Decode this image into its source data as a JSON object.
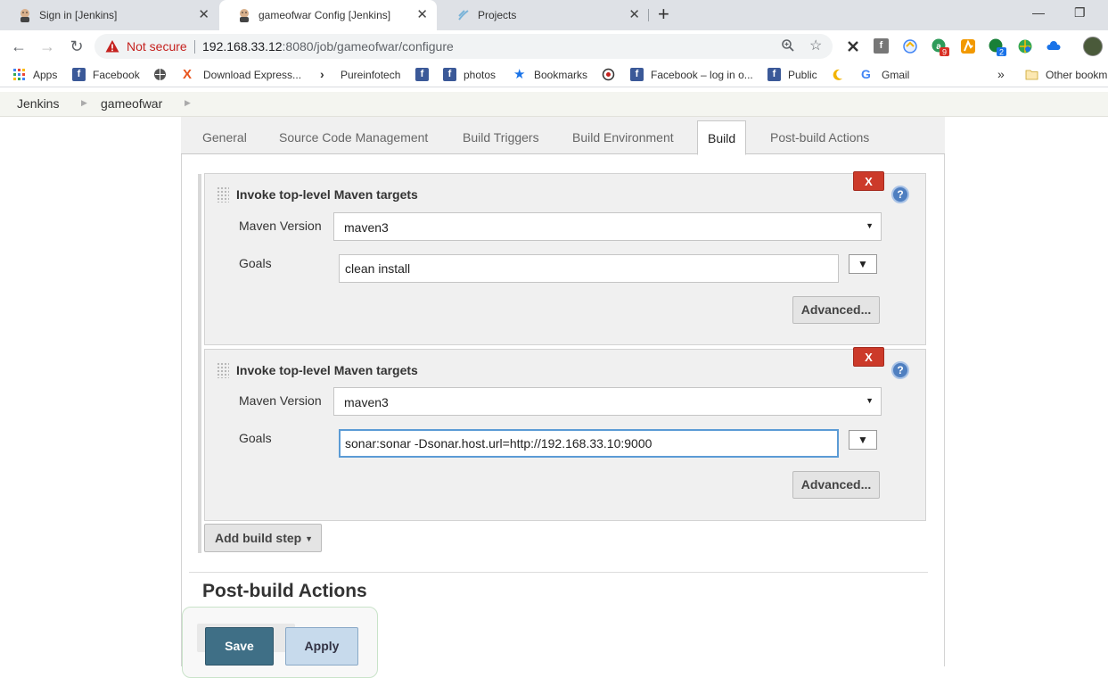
{
  "browser": {
    "tabs": [
      {
        "title": "Sign in [Jenkins]"
      },
      {
        "title": "gameofwar Config [Jenkins]"
      },
      {
        "title": "Projects"
      }
    ],
    "address": {
      "security_label": "Not secure",
      "host": "192.168.33.12",
      "path": ":8080/job/gameofwar/configure"
    },
    "bookmarks": [
      {
        "label": "Apps",
        "icon": "apps-grid-icon"
      },
      {
        "label": "Facebook",
        "icon": "facebook-icon"
      },
      {
        "label": "Download Express...",
        "icon": "x-icon"
      },
      {
        "label": "Pureinfotech",
        "icon": "pureinfotech-icon"
      },
      {
        "label": "photos",
        "icon": "facebook-icon"
      },
      {
        "label": "Bookmarks",
        "icon": "star-icon"
      },
      {
        "label": "Facebook – log in o...",
        "icon": "facebook-icon"
      },
      {
        "label": "Public",
        "icon": "facebook-icon"
      },
      {
        "label": "Gmail",
        "icon": "google-icon"
      },
      {
        "label": "Other bookm",
        "icon": "folder-icon"
      }
    ],
    "extension_badges": {
      "ext_a": "9",
      "ext_b": "2"
    }
  },
  "breadcrumb": [
    "Jenkins",
    "gameofwar"
  ],
  "config_tabs": [
    "General",
    "Source Code Management",
    "Build Triggers",
    "Build Environment",
    "Build",
    "Post-build Actions"
  ],
  "active_tab": "Build",
  "build_steps": [
    {
      "title": "Invoke top-level Maven targets",
      "maven_version_label": "Maven Version",
      "maven_version": "maven3",
      "goals_label": "Goals",
      "goals": "clean install",
      "advanced_label": "Advanced...",
      "delete_label": "X",
      "help_label": "?"
    },
    {
      "title": "Invoke top-level Maven targets",
      "maven_version_label": "Maven Version",
      "maven_version": "maven3",
      "goals_label": "Goals",
      "goals": "sonar:sonar -Dsonar.host.url=http://192.168.33.10:9000",
      "advanced_label": "Advanced...",
      "delete_label": "X",
      "help_label": "?"
    }
  ],
  "add_build_step_label": "Add build step",
  "post_build_title": "Post-build Actions",
  "buttons": {
    "save": "Save",
    "apply": "Apply"
  },
  "colors": {
    "save": "#3f6f86",
    "apply": "#c7daec",
    "delete": "#cc3a2a",
    "not_secure": "#c5221f"
  }
}
